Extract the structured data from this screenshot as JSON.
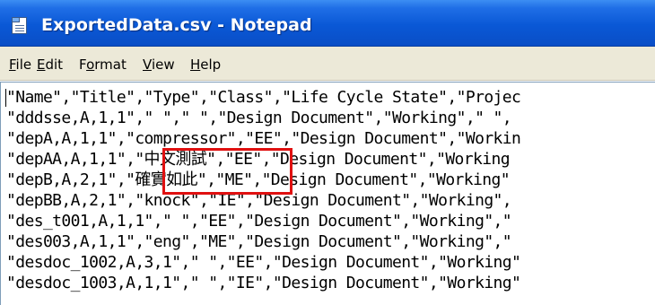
{
  "window": {
    "title": "ExportedData.csv - Notepad",
    "app_icon": "notepad-icon"
  },
  "menu": {
    "items": [
      {
        "accel": "F",
        "rest": "ile"
      },
      {
        "accel": "E",
        "rest": "dit"
      },
      {
        "pre": "F",
        "accel": "o",
        "rest": "rmat"
      },
      {
        "accel": "V",
        "rest": "iew"
      },
      {
        "accel": "H",
        "rest": "elp"
      }
    ]
  },
  "editor": {
    "lines": [
      "\"Name\",\"Title\",\"Type\",\"Class\",\"Life Cycle State\",\"Projec",
      "\"dddsse,A,1,1\",\" \",\" \",\"Design Document\",\"Working\",\" \",",
      "\"depA,A,1,1\",\"compressor\",\"EE\",\"Design Document\",\"Workin",
      "\"depAA,A,1,1\",\"中文測試\",\"EE\",\"Design Document\",\"Working",
      "\"depB,A,2,1\",\"確實如此\",\"ME\",\"Design Document\",\"Working\"",
      "\"depBB,A,2,1\",\"knock\",\"IE\",\"Design Document\",\"Working\",",
      "\"des_t001,A,1,1\",\" \",\"EE\",\"Design Document\",\"Working\",\"",
      "\"des003,A,1,1\",\"eng\",\"ME\",\"Design Document\",\"Working\",\"",
      "\"desdoc_1002,A,3,1\",\" \",\"EE\",\"Design Document\",\"Working\"",
      "\"desdoc_1003,A,1,1\",\" \",\"IE\",\"Design Document\",\"Working\""
    ]
  },
  "colors": {
    "titlebar": "#0a58d6",
    "menubar": "#ece9d8",
    "highlight": "#e01010"
  }
}
